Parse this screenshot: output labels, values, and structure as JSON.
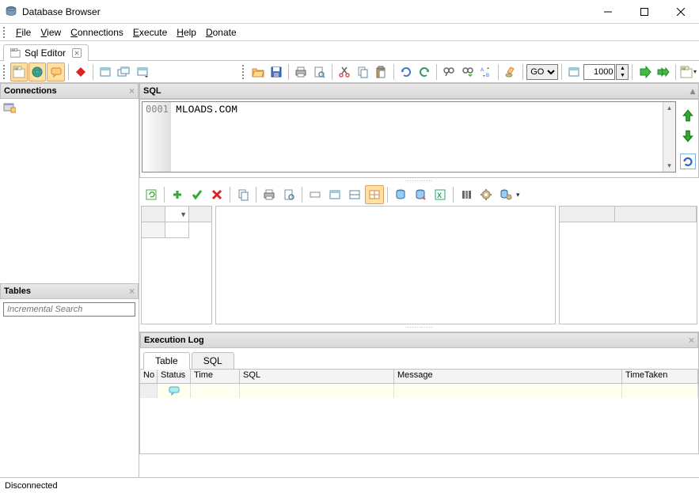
{
  "window": {
    "title": "Database Browser"
  },
  "menu": {
    "file": "File",
    "file_u": "F",
    "view": "View",
    "view_u": "V",
    "connections": "Connections",
    "connections_u": "C",
    "execute": "Execute",
    "execute_u": "E",
    "help": "Help",
    "help_u": "H",
    "donate": "Donate",
    "donate_u": "D"
  },
  "tabs": {
    "sql_editor": "Sql Editor"
  },
  "toolbar": {
    "go_option": "GO",
    "limit_value": "1000"
  },
  "panels": {
    "connections": "Connections",
    "tables": "Tables",
    "sql": "SQL",
    "execlog": "Execution Log"
  },
  "search": {
    "placeholder": "Incremental Search"
  },
  "editor": {
    "line_no": "0001",
    "content": "MLOADS.COM"
  },
  "exec_tabs": {
    "table": "Table",
    "sql": "SQL"
  },
  "exec_cols": {
    "no": "No",
    "status": "Status",
    "time": "Time",
    "sql": "SQL",
    "message": "Message",
    "timetaken": "TimeTaken"
  },
  "status": {
    "text": "Disconnected"
  }
}
